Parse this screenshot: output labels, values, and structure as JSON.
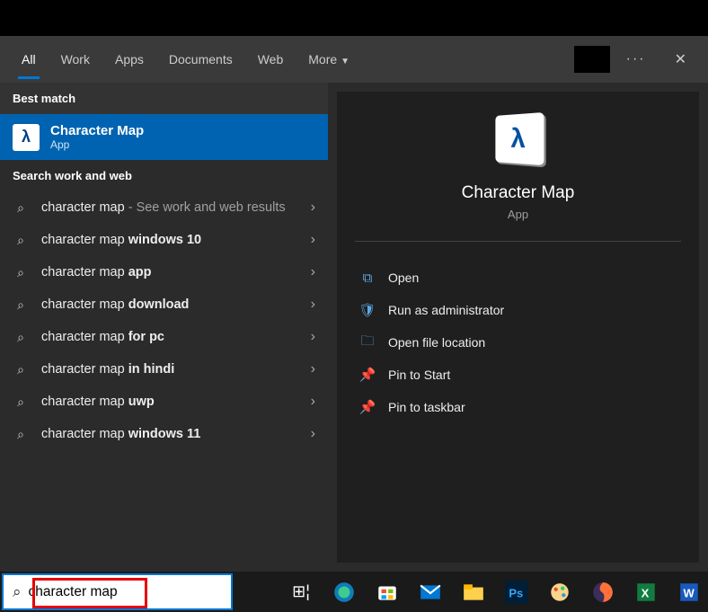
{
  "tabs": {
    "items": [
      "All",
      "Work",
      "Apps",
      "Documents",
      "Web",
      "More"
    ],
    "activeIndex": 0
  },
  "sections": {
    "best_match": "Best match",
    "search_ww": "Search work and web"
  },
  "best": {
    "title": "Character Map",
    "subtitle": "App"
  },
  "results": [
    {
      "prefix": "character map",
      "suffix": "",
      "trailing": " - See work and web results"
    },
    {
      "prefix": "character map ",
      "suffix": "windows 10",
      "trailing": ""
    },
    {
      "prefix": "character map ",
      "suffix": "app",
      "trailing": ""
    },
    {
      "prefix": "character map ",
      "suffix": "download",
      "trailing": ""
    },
    {
      "prefix": "character map ",
      "suffix": "for pc",
      "trailing": ""
    },
    {
      "prefix": "character map ",
      "suffix": "in hindi",
      "trailing": ""
    },
    {
      "prefix": "character map ",
      "suffix": "uwp",
      "trailing": ""
    },
    {
      "prefix": "character map ",
      "suffix": "windows 11",
      "trailing": ""
    }
  ],
  "right": {
    "title": "Character Map",
    "subtitle": "App"
  },
  "actions": [
    {
      "icon": "open",
      "label": "Open"
    },
    {
      "icon": "admin",
      "label": "Run as administrator"
    },
    {
      "icon": "folder",
      "label": "Open file location"
    },
    {
      "icon": "pin",
      "label": "Pin to Start"
    },
    {
      "icon": "pin",
      "label": "Pin to taskbar"
    }
  ],
  "search_input": {
    "value": "character map"
  },
  "taskbar_icons": [
    "task-view",
    "edge",
    "store",
    "mail",
    "explorer",
    "photoshop",
    "paint",
    "firefox",
    "excel",
    "word"
  ]
}
